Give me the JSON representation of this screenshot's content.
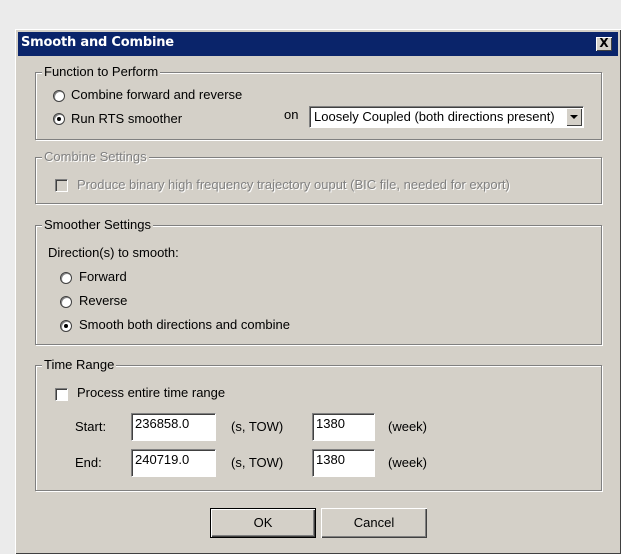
{
  "dialog": {
    "title": "Smooth and Combine",
    "close_symbol": "X"
  },
  "function_group": {
    "legend": "Function to Perform",
    "options": [
      {
        "label": "Combine forward and reverse",
        "checked": false
      },
      {
        "label": "Run RTS smoother",
        "checked": true
      }
    ],
    "on_label": "on",
    "mode_select_value": "Loosely Coupled (both directions present)"
  },
  "combine_group": {
    "legend": "Combine Settings",
    "checkbox_label": "Produce binary high frequency trajectory ouput (BIC file, needed for export)",
    "checked": false,
    "disabled": true
  },
  "smoother_group": {
    "legend": "Smoother Settings",
    "direction_label": "Direction(s) to smooth:",
    "options": [
      {
        "label": "Forward",
        "checked": false
      },
      {
        "label": "Reverse",
        "checked": false
      },
      {
        "label": "Smooth both directions and combine",
        "checked": true
      }
    ]
  },
  "time_group": {
    "legend": "Time Range",
    "entire_label": "Process entire time range",
    "entire_checked": false,
    "start_label": "Start:",
    "start_value": "236858.0",
    "end_label": "End:",
    "end_value": "240719.0",
    "tow_unit": "(s, TOW)",
    "start_week": "1380",
    "end_week": "1380",
    "week_unit": "(week)"
  },
  "buttons": {
    "ok": "OK",
    "cancel": "Cancel"
  }
}
